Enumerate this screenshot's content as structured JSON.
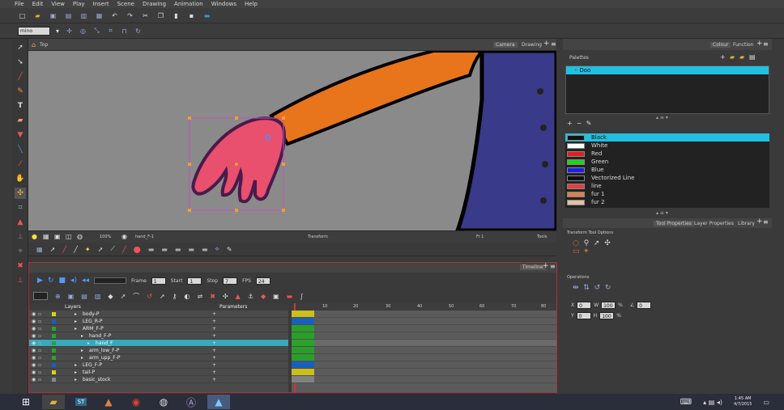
{
  "menu": [
    "File",
    "Edit",
    "View",
    "Play",
    "Insert",
    "Scene",
    "Drawing",
    "Animation",
    "Windows",
    "Help"
  ],
  "toolbar": {
    "zoom_combo": "mino"
  },
  "camera_view": {
    "breadcrumb": "Top",
    "tabs": [
      "Camera",
      "Drawing"
    ],
    "zoom": "100%",
    "drawing_name": "hand_F-1",
    "mode": "Transform",
    "frame": "Fr 1",
    "tools_label": "Tools"
  },
  "timeline": {
    "tab": "Timeline",
    "frame_label": "Frame",
    "frame": "1",
    "start_label": "Start",
    "start": "1",
    "stop_label": "Stop",
    "stop": "7",
    "fps_label": "FPS",
    "fps": "24",
    "columns": {
      "layers": "Layers",
      "parameters": "Parameters"
    },
    "ruler": [
      "10",
      "20",
      "30",
      "40",
      "50",
      "60",
      "70",
      "80"
    ],
    "layers": [
      {
        "name": "body-P",
        "indent": 0,
        "color": "#e0d010",
        "selected": false
      },
      {
        "name": "LEG_R-P",
        "indent": 0,
        "color": "#1060d0",
        "selected": false
      },
      {
        "name": "ARM_F-P",
        "indent": 0,
        "color": "#22aa22",
        "selected": false
      },
      {
        "name": "hand_F-P",
        "indent": 1,
        "color": "#22aa22",
        "selected": false
      },
      {
        "name": "hand_F",
        "indent": 2,
        "color": "#22aa22",
        "selected": true
      },
      {
        "name": "arm_low_F-P",
        "indent": 1,
        "color": "#22aa22",
        "selected": false
      },
      {
        "name": "arm_upp_F-P",
        "indent": 1,
        "color": "#22aa22",
        "selected": false
      },
      {
        "name": "LEG_F-P",
        "indent": 0,
        "color": "#1060d0",
        "selected": false
      },
      {
        "name": "tail-P",
        "indent": 0,
        "color": "#e0d010",
        "selected": false
      },
      {
        "name": "basic_stock",
        "indent": 0,
        "color": "#888888",
        "selected": false
      }
    ]
  },
  "right_panel": {
    "tabs": [
      "Colour",
      "Function"
    ],
    "palettes_label": "Palettes",
    "palette_name": "Doo",
    "swatches": [
      {
        "name": "Black",
        "color": "#111111",
        "selected": true
      },
      {
        "name": "White",
        "color": "#ffffff",
        "selected": false
      },
      {
        "name": "Red",
        "color": "#e02020",
        "selected": false
      },
      {
        "name": "Green",
        "color": "#22d022",
        "selected": false
      },
      {
        "name": "Blue",
        "color": "#2020e0",
        "selected": false
      },
      {
        "name": "Vectorized Line",
        "color": "#111111",
        "selected": false
      },
      {
        "name": "line",
        "color": "#e04040",
        "selected": false
      },
      {
        "name": "fur 1",
        "color": "#d88050",
        "selected": false
      },
      {
        "name": "fur 2",
        "color": "#e8c0a0",
        "selected": false
      }
    ],
    "bottom_tabs": [
      "Tool Properties",
      "Layer Properties",
      "Library"
    ],
    "tool_options_label": "Transform Tool Options",
    "operations_label": "Operations",
    "fields": {
      "x1": "0",
      "w": "100",
      "pct": "%",
      "y1": "0",
      "h": "100",
      "deg": "0"
    }
  },
  "taskbar": {
    "time": "1:45 AM",
    "date": "4/7/2015"
  },
  "colors": {
    "accent": "#3aa8b8",
    "timeline_border": "#aa3333",
    "palette_header": "#22c0e0"
  }
}
